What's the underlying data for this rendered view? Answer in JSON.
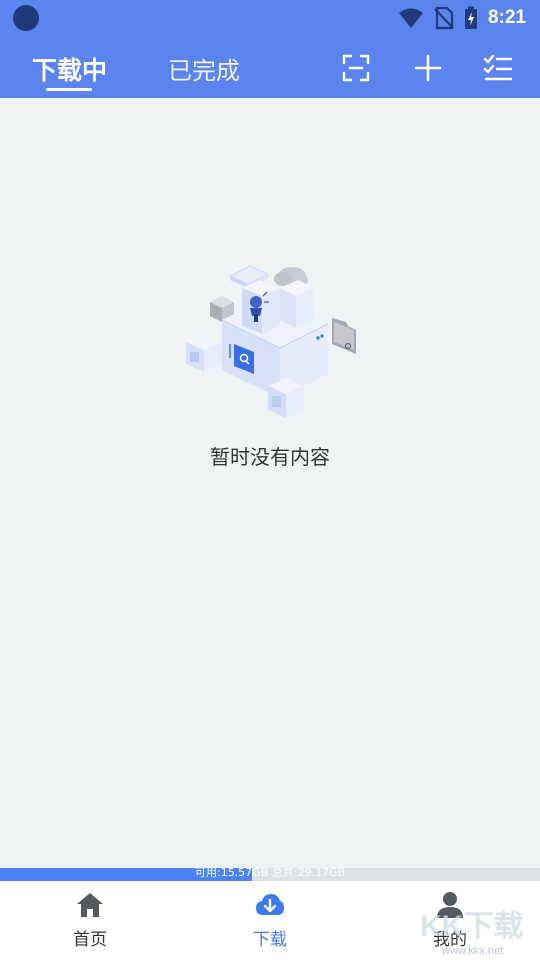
{
  "status_bar": {
    "time": "8:21"
  },
  "header": {
    "tabs": [
      {
        "label": "下载中",
        "active": true
      },
      {
        "label": "已完成",
        "active": false
      }
    ],
    "buttons": {
      "scan_icon": "scan-minus-icon",
      "add_icon": "plus-icon",
      "menu_icon": "checklist-icon"
    }
  },
  "main": {
    "empty_state_text": "暂时没有内容",
    "illustration_icon": "isometric-empty-boxes-illustration"
  },
  "storage": {
    "text": "可用:15.57GB 总共:29.17GB",
    "available_gb": 15.57,
    "total_gb": 29.17,
    "used_fraction": 0.466
  },
  "bottom_nav": {
    "items": [
      {
        "label": "首页",
        "icon": "home-icon",
        "active": false
      },
      {
        "label": "下载",
        "icon": "cloud-download-icon",
        "active": true
      },
      {
        "label": "我的",
        "icon": "user-icon",
        "active": false
      }
    ]
  },
  "watermark": {
    "text": "KK下载",
    "url": "www.kkx.net"
  },
  "colors": {
    "accent": "#5b84ee",
    "active_nav": "#3d7af0",
    "background": "#eef3f4"
  }
}
